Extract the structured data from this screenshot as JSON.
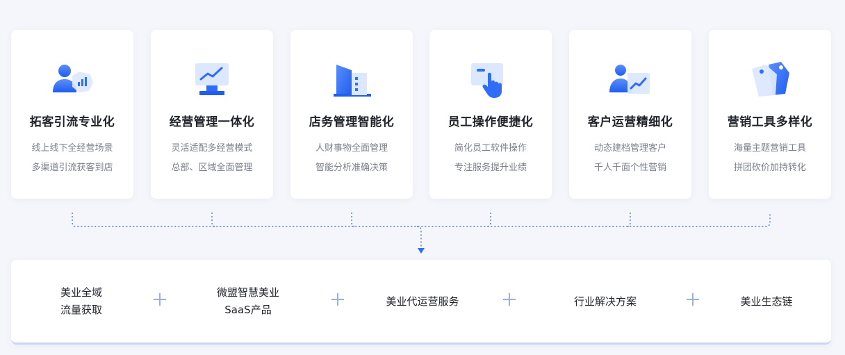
{
  "cards": [
    {
      "icon": "user-chart-icon",
      "title": "拓客引流专业化",
      "line1": "线上线下全经营场景",
      "line2": "多渠道引流获客到店"
    },
    {
      "icon": "monitor-chart-icon",
      "title": "经营管理一体化",
      "line1": "灵活适配多经营模式",
      "line2": "总部、区域全面管理"
    },
    {
      "icon": "building-icon",
      "title": "店务管理智能化",
      "line1": "人财事物全面管理",
      "line2": "智能分析准确决策"
    },
    {
      "icon": "hand-click-icon",
      "title": "员工操作便捷化",
      "line1": "简化员工软件操作",
      "line2": "专注服务提升业绩"
    },
    {
      "icon": "user-trend-icon",
      "title": "客户运营精细化",
      "line1": "动态建档管理客户",
      "line2": "千人千面个性营销"
    },
    {
      "icon": "tags-icon",
      "title": "营销工具多样化",
      "line1": "海量主题营销工具",
      "line2": "拼团砍价加持转化"
    }
  ],
  "bottom": {
    "item1": {
      "line1": "美业全域",
      "line2": "流量获取"
    },
    "item2": {
      "line1": "微盟智慧美业",
      "line2": "SaaS产品"
    },
    "item3": "美业代运营服务",
    "item4": "行业解决方案",
    "item5": "美业生态链"
  },
  "colors": {
    "accent": "#2f6df6",
    "icon_light": "#c9dbff",
    "muted_text": "#7a808c"
  }
}
